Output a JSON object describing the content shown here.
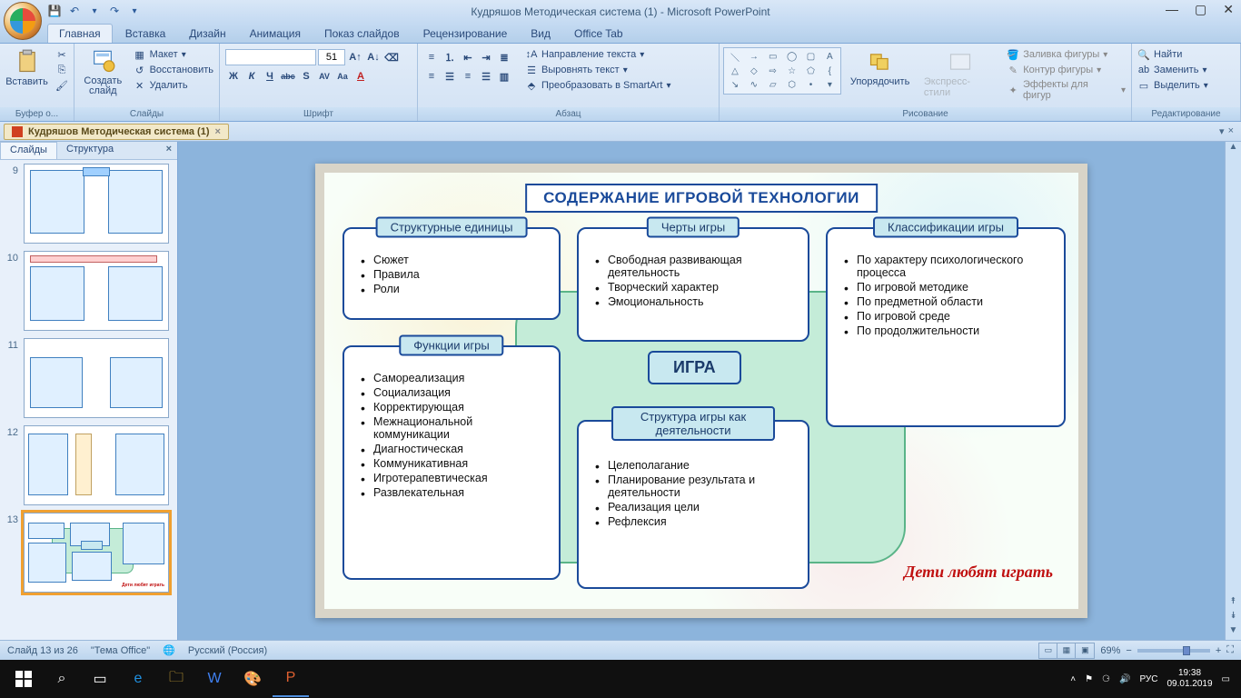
{
  "window": {
    "title": "Кудряшов Методическая система (1) - Microsoft PowerPoint"
  },
  "qat": {
    "save": "💾",
    "undo": "↶",
    "redo": "↷",
    "more": "▾"
  },
  "tabs": {
    "home": "Главная",
    "insert": "Вставка",
    "design": "Дизайн",
    "animation": "Анимация",
    "slideshow": "Показ слайдов",
    "review": "Рецензирование",
    "view": "Вид",
    "officetab": "Office Tab"
  },
  "ribbon": {
    "clipboard": {
      "paste": "Вставить",
      "label": "Буфер о..."
    },
    "slides": {
      "new": "Создать слайд",
      "layout": "Макет",
      "reset": "Восстановить",
      "delete": "Удалить",
      "label": "Слайды"
    },
    "font": {
      "size": "51",
      "label": "Шрифт",
      "b": "Ж",
      "i": "К",
      "u": "Ч",
      "strike": "abc",
      "shadow": "S",
      "spacing": "AV",
      "case": "Aa",
      "color": "A"
    },
    "paragraph": {
      "textdir": "Направление текста",
      "align": "Выровнять текст",
      "smartart": "Преобразовать в SmartArt",
      "label": "Абзац"
    },
    "drawing": {
      "arrange": "Упорядочить",
      "styles": "Экспресс-стили",
      "fill": "Заливка фигуры",
      "outline": "Контур фигуры",
      "effects": "Эффекты для фигур",
      "label": "Рисование"
    },
    "editing": {
      "find": "Найти",
      "replace": "Заменить",
      "select": "Выделить",
      "label": "Редактирование"
    }
  },
  "doctab": {
    "name": "Кудряшов Методическая система (1)"
  },
  "panel": {
    "slides": "Слайды",
    "structure": "Структура"
  },
  "thumbs": {
    "n9": "9",
    "n10": "10",
    "n11": "11",
    "n12": "12",
    "n13": "13"
  },
  "slide13": {
    "title": "СОДЕРЖАНИЕ ИГРОВОЙ ТЕХНОЛОГИИ",
    "struct_units": {
      "header": "Структурные единицы",
      "i1": "Сюжет",
      "i2": "Правила",
      "i3": "Роли"
    },
    "traits": {
      "header": "Черты игры",
      "i1": "Свободная развивающая деятельность",
      "i2": "Творческий характер",
      "i3": "Эмоциональность"
    },
    "classif": {
      "header": "Классификации игры",
      "i1": "По характеру психологического процесса",
      "i2": "По игровой методике",
      "i3": "По предметной области",
      "i4": "По игровой среде",
      "i5": "По продолжительности"
    },
    "functions": {
      "header": "Функции игры",
      "i1": "Самореализация",
      "i2": "Социализация",
      "i3": "Корректирующая",
      "i4": "Межнациональной коммуникации",
      "i5": "Диагностическая",
      "i6": "Коммуникативная",
      "i7": "Игротерапевтическая",
      "i8": "Развлекательная"
    },
    "structure": {
      "header": "Структура игры как деятельности",
      "i1": "Целеполагание",
      "i2": "Планирование результата и деятельности",
      "i3": "Реализация цели",
      "i4": "Рефлексия"
    },
    "igra": "ИГРА",
    "children": "Дети любят играть"
  },
  "status": {
    "slide": "Слайд 13 из 26",
    "theme": "\"Тема Office\"",
    "lang": "Русский (Россия)",
    "zoom": "69%"
  },
  "tray": {
    "lang": "РУС",
    "time": "19:38",
    "date": "09.01.2019"
  }
}
